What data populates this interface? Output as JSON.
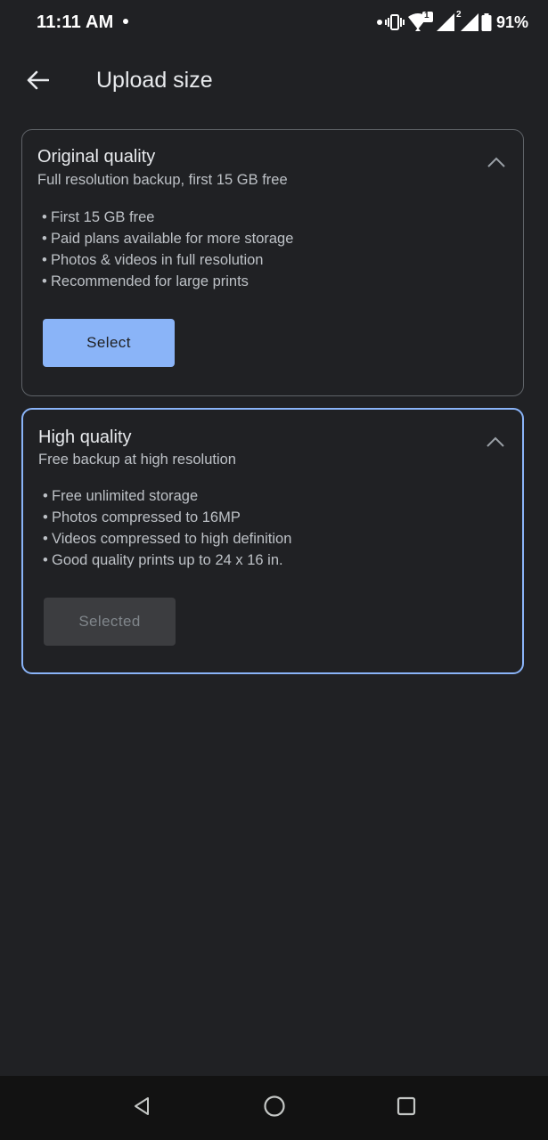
{
  "status_bar": {
    "time": "11:11 AM",
    "battery_percent": "91%",
    "sim_badge_1": "1",
    "sim_badge_2": "2"
  },
  "app_bar": {
    "title": "Upload size"
  },
  "options": [
    {
      "title": "Original quality",
      "subtitle": "Full resolution backup, first 15 GB free",
      "bullets": [
        "First 15 GB free",
        "Paid plans available for more storage",
        "Photos & videos in full resolution",
        "Recommended for large prints"
      ],
      "button_label": "Select",
      "selected": false
    },
    {
      "title": "High quality",
      "subtitle": "Free backup at high resolution",
      "bullets": [
        "Free unlimited storage",
        "Photos compressed to 16MP",
        "Videos compressed to high definition",
        "Good quality prints up to 24 x 16 in."
      ],
      "button_label": "Selected",
      "selected": true
    }
  ],
  "colors": {
    "background": "#202124",
    "accent": "#8ab4f8",
    "card_border": "#5f6368",
    "nav_bar": "#121212"
  },
  "bullet_glyph": "•"
}
